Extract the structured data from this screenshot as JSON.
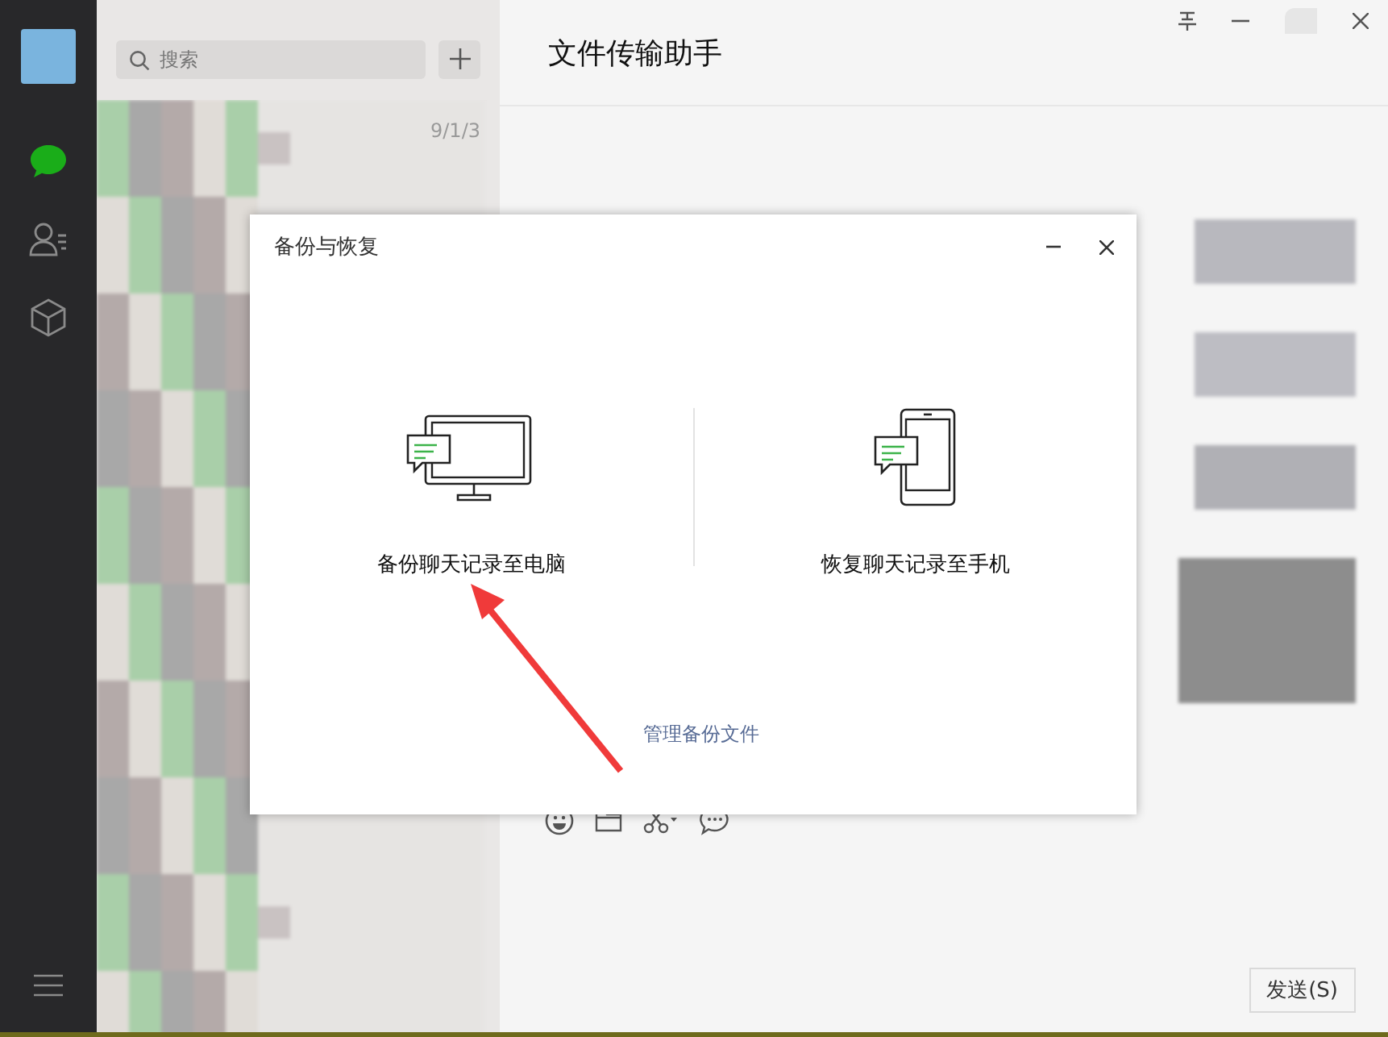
{
  "sidebar": {
    "items": [
      {
        "kind": "chat",
        "selected": true
      },
      {
        "kind": "contacts",
        "selected": false
      },
      {
        "kind": "favorites",
        "selected": false
      }
    ]
  },
  "search": {
    "placeholder": "搜索"
  },
  "chat_list": {
    "items": [
      {
        "time": "9/1/3"
      }
    ]
  },
  "chat": {
    "title": "文件传输助手",
    "send_button": "发送(S)"
  },
  "dialog": {
    "title": "备份与恢复",
    "options": [
      {
        "kind": "computer",
        "label": "备份聊天记录至电脑"
      },
      {
        "kind": "phone",
        "label": "恢复聊天记录至手机"
      }
    ],
    "link": "管理备份文件"
  }
}
